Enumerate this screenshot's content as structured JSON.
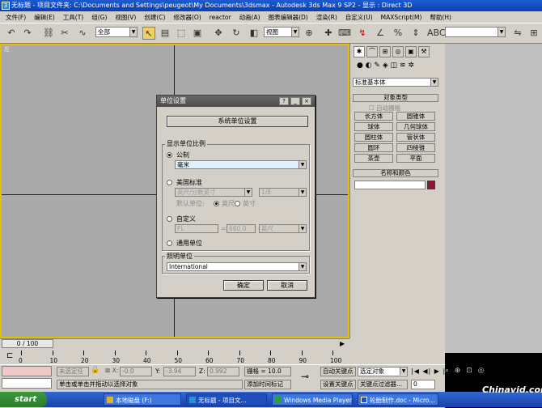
{
  "titlebar": {
    "title": "无标题   - 项目文件夹: C:\\Documents and Settings\\peugeot\\My Documents\\3dsmax     - Autodesk 3ds Max 9 SP2     - 显示 : Direct 3D"
  },
  "menu": [
    "文件(F)",
    "编辑(E)",
    "工具(T)",
    "组(G)",
    "视图(V)",
    "创建(C)",
    "修改器(O)",
    "reactor",
    "动画(A)",
    "图表编辑器(D)",
    "渲染(R)",
    "自定义(U)",
    "MAXScript(M)",
    "帮助(H)"
  ],
  "toolbar": {
    "selection_filter": "全部",
    "ref_coord": "视图",
    "named_selection": ""
  },
  "viewport": {
    "corner_label": "左"
  },
  "cmdpanel": {
    "category": "标准基本体",
    "object_type_title": "对象类型",
    "autogrid": "自动栅格",
    "objects": [
      "长方体",
      "圆锥体",
      "球体",
      "几何球体",
      "圆柱体",
      "管状体",
      "圆环",
      "四棱锥",
      "茶壶",
      "平面"
    ],
    "name_color_title": "名称和颜色",
    "color": "#8b1a3a"
  },
  "dialog": {
    "title": "单位设置",
    "system_units_button": "系统单位设置",
    "display_scale_label": "显示单位比例",
    "metric_label": "公制",
    "metric_value": "毫米",
    "us_standard_label": "美国标准",
    "us_value": "英尺/分数英寸",
    "us_fraction": "1/8",
    "default_units_label": "默认单位:",
    "feet_label": "英尺",
    "inches_label": "英寸",
    "custom_label": "自定义",
    "custom_name": "FL",
    "custom_equals": "=",
    "custom_value": "660.0",
    "custom_unit": "英尺",
    "generic_label": "通用单位",
    "lighting_label": "照明单位",
    "lighting_value": "International",
    "ok_button": "确定",
    "cancel_button": "取消"
  },
  "timeline": {
    "slider": "0 / 100",
    "ticks": [
      "0",
      "10",
      "20",
      "30",
      "40",
      "50",
      "60",
      "70",
      "80",
      "90",
      "100"
    ]
  },
  "status": {
    "selection": "未选定任",
    "x_value": "-0.0",
    "y_value": "-3.94",
    "z_value": "0.992",
    "grid": "栅格 = 10.0",
    "prompt": "单击或单击并拖动以选择对象",
    "add_time_tag": "添加时间标记",
    "auto_key": "自动关键点",
    "set_key": "设置关键点",
    "selected_object": "选定对象",
    "key_filters": "关键点过滤器...",
    "frame": "0"
  },
  "taskbar": {
    "start": "start",
    "tasks": [
      "本地磁盘 (F:)",
      "无标题  - 项目文...",
      "Windows Media Player",
      "轮胎制作.doc - Micro..."
    ]
  },
  "watermark": "Chinavid.com"
}
